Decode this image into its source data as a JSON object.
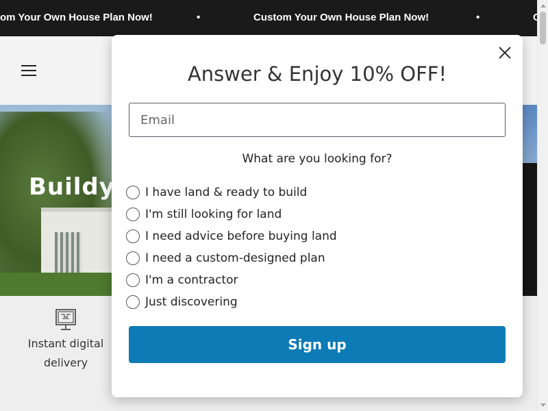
{
  "announcement": {
    "message_partial": "om Your Own House Plan Now!",
    "message": "Custom Your Own House Plan Now!",
    "separator": "•",
    "bg_color": "#1a1a1a"
  },
  "header": {
    "menu_icon": "hamburger-menu-icon"
  },
  "hero": {
    "title_partial": "Buildy"
  },
  "features": {
    "items": [
      {
        "icon": "blueprint-monitor-icon",
        "line1": "Instant digital",
        "line2": "delivery"
      }
    ]
  },
  "modal": {
    "title": "Answer & Enjoy 10% OFF!",
    "email_placeholder": "Email",
    "email_value": "",
    "question": "What are you looking for?",
    "options": [
      {
        "label": "I have land & ready to build",
        "selected": false
      },
      {
        "label": "I'm still looking for land",
        "selected": false
      },
      {
        "label": "I need advice before buying land",
        "selected": false
      },
      {
        "label": "I need a custom-designed plan",
        "selected": false
      },
      {
        "label": "I'm a contractor",
        "selected": false
      },
      {
        "label": "Just discovering",
        "selected": false
      }
    ],
    "submit_label": "Sign up",
    "submit_color": "#0d7bb5",
    "close_icon": "close-icon"
  }
}
